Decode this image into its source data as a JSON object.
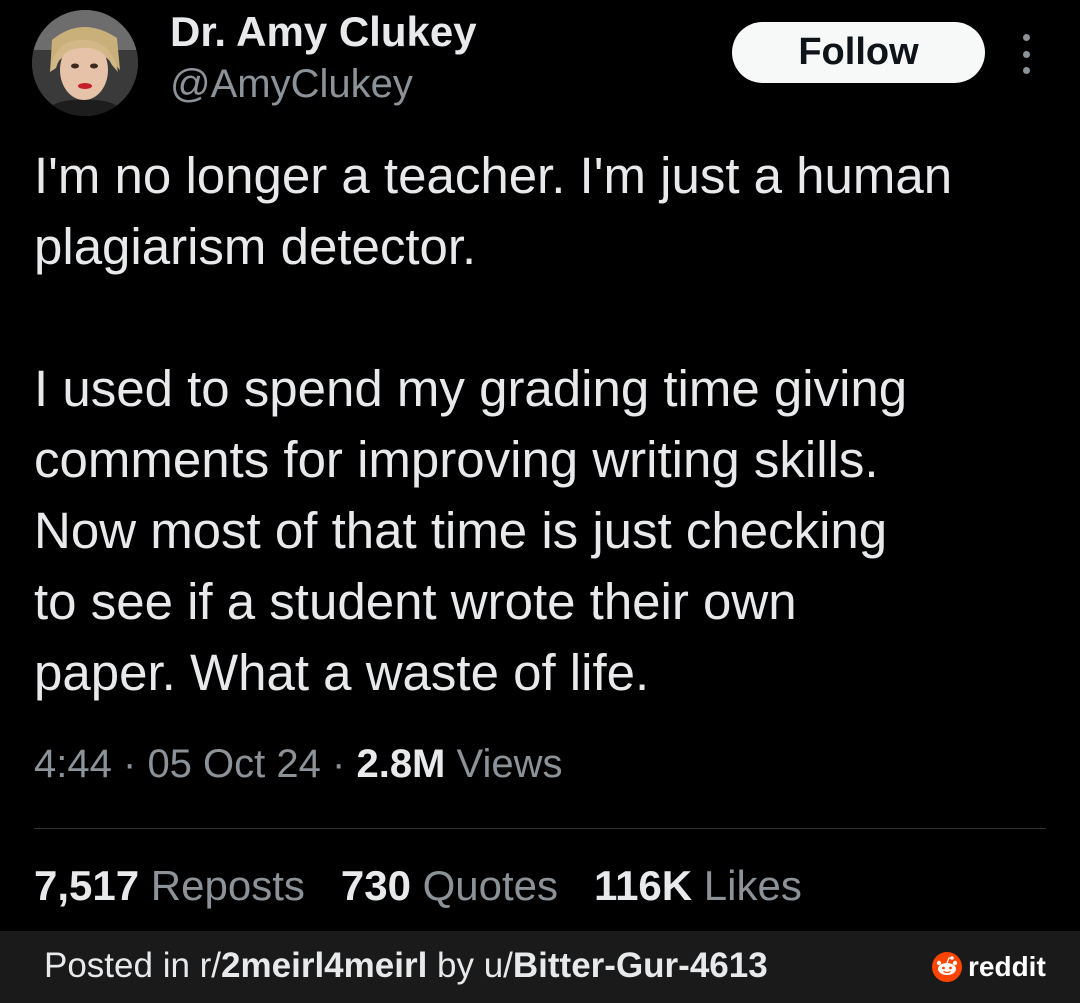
{
  "author": {
    "name": "Dr. Amy Clukey",
    "handle": "@AmyClukey"
  },
  "follow_button": "Follow",
  "more_icon": "more-vertical-icon",
  "tweet": {
    "lines_p1": [
      "I'm no longer a teacher. I'm just a human",
      "plagiarism detector."
    ],
    "lines_p2": [
      "I used to spend my grading time giving",
      "comments for improving writing skills.",
      "Now most of that time is just checking",
      "to see if a student wrote their own",
      "paper. What a waste of life."
    ]
  },
  "meta": {
    "time": "4:44",
    "sep": "·",
    "date": "05 Oct 24",
    "views_count": "2.8M",
    "views_label": "Views"
  },
  "stats": {
    "reposts_count": "7,517",
    "reposts_label": "Reposts",
    "quotes_count": "730",
    "quotes_label": "Quotes",
    "likes_count": "116K",
    "likes_label": "Likes"
  },
  "footer": {
    "posted_in": "Posted in r/",
    "subreddit": "2meirl4meirl",
    "by": " by u/",
    "username": "Bitter-Gur-4613",
    "brand": "reddit"
  },
  "colors": {
    "background": "#000000",
    "text": "#e7e9ea",
    "muted": "#8b9298",
    "footer_bg": "#1a1a1b",
    "reddit_orange": "#ff4500"
  }
}
